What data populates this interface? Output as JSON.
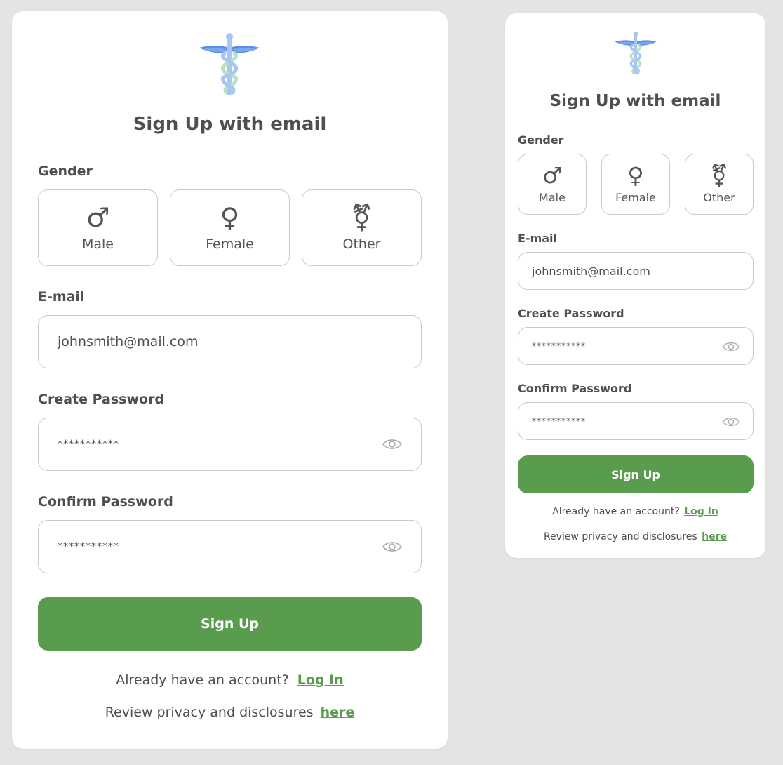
{
  "colors": {
    "accent": "#599c4d",
    "background": "#e4e4e4",
    "card": "#ffffff",
    "text": "#4f4f4f",
    "border": "#c9c9c9"
  },
  "icons": {
    "logo": "caduceus-icon",
    "male": "male-symbol-icon",
    "female": "female-symbol-icon",
    "other": "transgender-symbol-icon",
    "eye": "eye-icon"
  },
  "large": {
    "title": "Sign Up with email",
    "gender_label": "Gender",
    "genders": [
      {
        "glyph": "♂",
        "label": "Male"
      },
      {
        "glyph": "♀",
        "label": "Female"
      },
      {
        "glyph": "⚧",
        "label": "Other"
      }
    ],
    "email_label": "E-mail",
    "email_value": "johnsmith@mail.com",
    "password_label": "Create Password",
    "password_value": "***********",
    "confirm_label": "Confirm Password",
    "confirm_value": "***********",
    "signup_button": "Sign Up",
    "account_text": "Already have an account?",
    "login_link": "Log In",
    "privacy_text": "Review privacy and disclosures",
    "privacy_link": "here"
  },
  "small": {
    "title": "Sign Up with email",
    "gender_label": "Gender",
    "genders": [
      {
        "glyph": "♂",
        "label": "Male"
      },
      {
        "glyph": "♀",
        "label": "Female"
      },
      {
        "glyph": "⚧",
        "label": "Other"
      }
    ],
    "email_label": "E-mail",
    "email_value": "johnsmith@mail.com",
    "password_label": "Create Password",
    "password_value": "***********",
    "confirm_label": "Confirm Password",
    "confirm_value": "***********",
    "signup_button": "Sign Up",
    "account_text": "Already have an account?",
    "login_link": "Log In",
    "privacy_text": "Review privacy and disclosures",
    "privacy_link": "here"
  }
}
